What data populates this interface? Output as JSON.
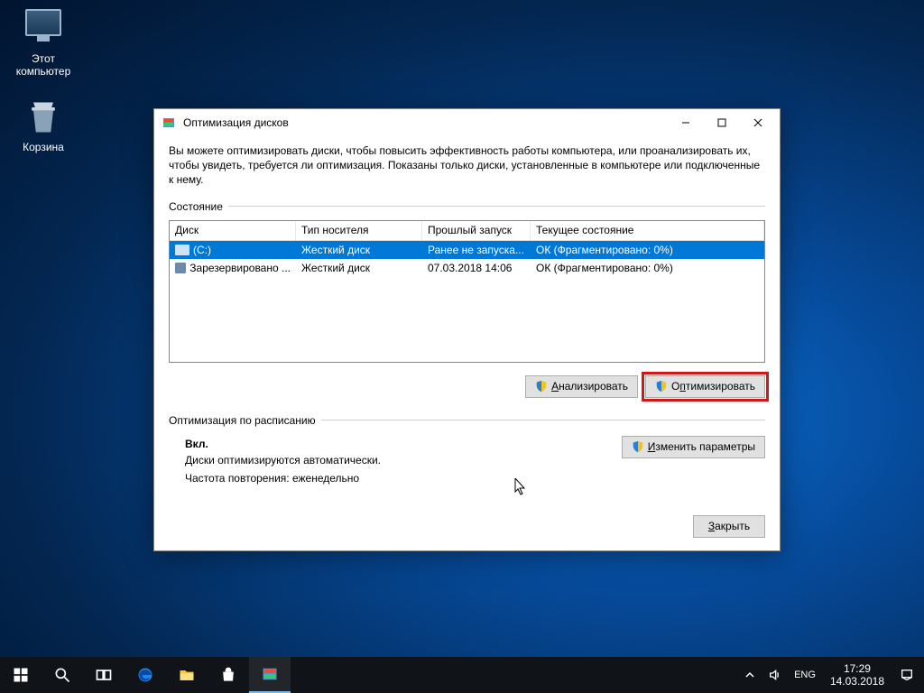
{
  "desktop": {
    "icons": [
      {
        "label": "Этот компьютер"
      },
      {
        "label": "Корзина"
      }
    ]
  },
  "dialog": {
    "title": "Оптимизация дисков",
    "description": "Вы можете оптимизировать диски, чтобы повысить эффективность работы компьютера, или проанализировать их, чтобы увидеть, требуется ли оптимизация. Показаны только диски, установленные в компьютере или подключенные к нему.",
    "section_status": "Состояние",
    "columns": {
      "disk": "Диск",
      "media": "Тип носителя",
      "last": "Прошлый запуск",
      "current": "Текущее состояние"
    },
    "rows": [
      {
        "name": "(C:)",
        "media": "Жесткий диск",
        "last": "Ранее не запуска...",
        "current": "ОК (Фрагментировано: 0%)",
        "selected": true
      },
      {
        "name": "Зарезервировано ...",
        "media": "Жесткий диск",
        "last": "07.03.2018 14:06",
        "current": "ОК (Фрагментировано: 0%)",
        "selected": false
      }
    ],
    "buttons": {
      "analyze": "Анализировать",
      "optimize": "Оптимизировать",
      "change": "Изменить параметры",
      "close": "Закрыть"
    },
    "section_schedule": "Оптимизация по расписанию",
    "schedule": {
      "status": "Вкл.",
      "desc": "Диски оптимизируются автоматически.",
      "freq": "Частота повторения: еженедельно"
    }
  },
  "taskbar": {
    "lang": "ENG",
    "time": "17:29",
    "date": "14.03.2018"
  }
}
